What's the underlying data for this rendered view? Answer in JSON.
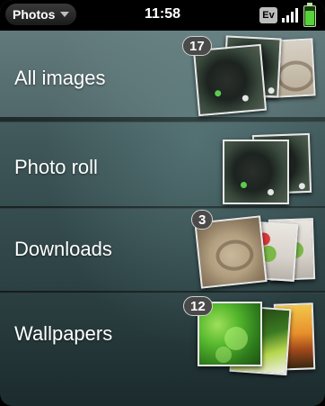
{
  "status_bar": {
    "app_menu_label": "Photos",
    "time": "11:58",
    "network_label": "Ev",
    "signal_bars": 4,
    "battery_level": 0.9
  },
  "albums": [
    {
      "label": "All images",
      "count": "17",
      "thumbnails": [
        "dark-night-photo",
        "stone-sculpture-photo"
      ]
    },
    {
      "label": "Photo roll",
      "count": "",
      "thumbnails": [
        "dark-night-photo",
        "dark-night-photo"
      ]
    },
    {
      "label": "Downloads",
      "count": "3",
      "thumbnails": [
        "sand-art-photo",
        "room-photo",
        "room-photo"
      ]
    },
    {
      "label": "Wallpapers",
      "count": "12",
      "thumbnails": [
        "green-leaves-photo",
        "flower-photo",
        "sunset-photo"
      ]
    }
  ],
  "colors": {
    "background_top": "#5d7779",
    "background_bottom": "#1c2b2d",
    "battery": "#56d33a"
  }
}
